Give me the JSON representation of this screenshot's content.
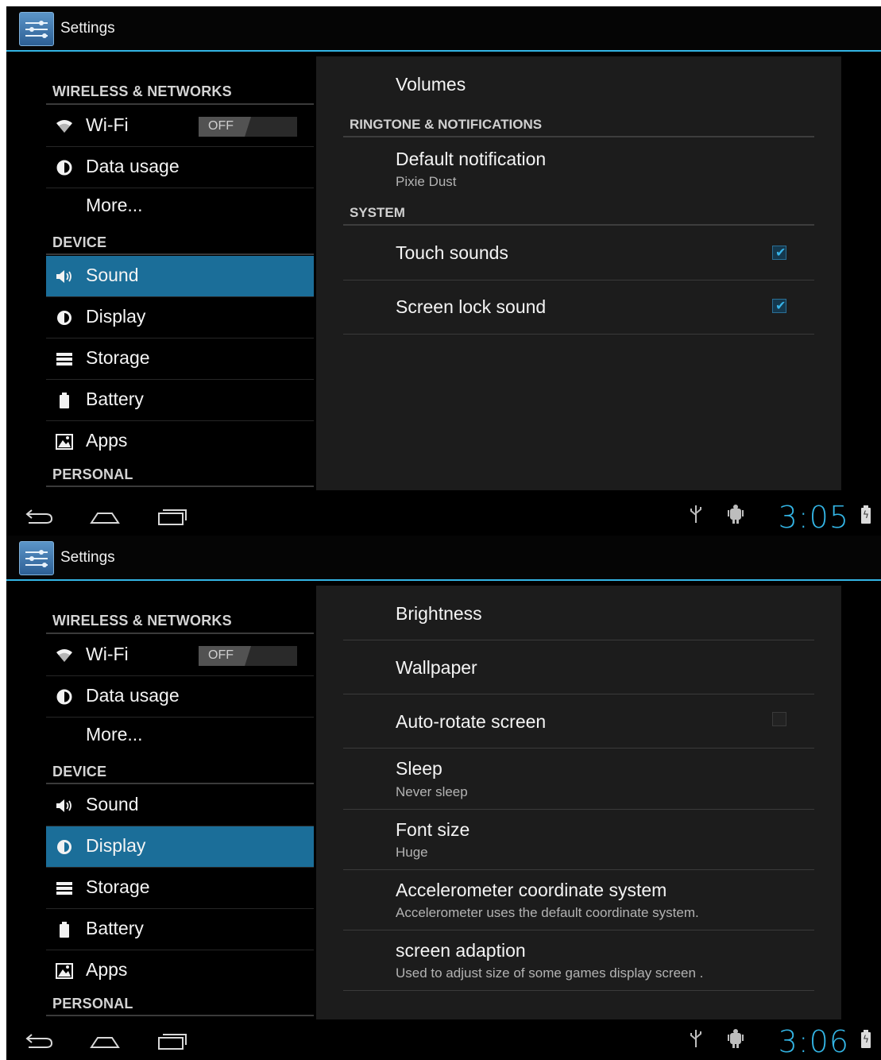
{
  "screens": [
    {
      "app_title": "Settings",
      "nav": {
        "wireless_header": "WIRELESS & NETWORKS",
        "wifi_label": "Wi-Fi",
        "wifi_toggle": "OFF",
        "data_usage": "Data usage",
        "more": "More...",
        "device_header": "DEVICE",
        "sound": "Sound",
        "display": "Display",
        "storage": "Storage",
        "battery": "Battery",
        "apps": "Apps",
        "personal_header": "PERSONAL",
        "selected": "Sound"
      },
      "detail": {
        "volumes": "Volumes",
        "ringtone_header": "RINGTONE & NOTIFICATIONS",
        "default_notification": "Default notification",
        "default_notification_summary": "Pixie Dust",
        "system_header": "SYSTEM",
        "touch_sounds": "Touch sounds",
        "touch_sounds_checked": true,
        "screen_lock_sound": "Screen lock sound",
        "screen_lock_sound_checked": true
      },
      "clock": "3:05"
    },
    {
      "app_title": "Settings",
      "nav": {
        "wireless_header": "WIRELESS & NETWORKS",
        "wifi_label": "Wi-Fi",
        "wifi_toggle": "OFF",
        "data_usage": "Data usage",
        "more": "More...",
        "device_header": "DEVICE",
        "sound": "Sound",
        "display": "Display",
        "storage": "Storage",
        "battery": "Battery",
        "apps": "Apps",
        "personal_header": "PERSONAL",
        "selected": "Display"
      },
      "detail": {
        "brightness": "Brightness",
        "wallpaper": "Wallpaper",
        "auto_rotate": "Auto-rotate screen",
        "auto_rotate_checked": false,
        "sleep": "Sleep",
        "sleep_summary": "Never sleep",
        "font_size": "Font size",
        "font_size_summary": "Huge",
        "accelerometer": "Accelerometer coordinate system",
        "accelerometer_summary": "Accelerometer uses the default coordinate system.",
        "screen_adaption": "screen adaption",
        "screen_adaption_summary": "Used to adjust size of some games display screen ."
      },
      "clock": "3:06"
    }
  ],
  "icons": {
    "app": "settings-icon",
    "wifi": "wifi-icon",
    "data_usage": "data-usage-icon",
    "sound": "speaker-icon",
    "display": "brightness-icon",
    "storage": "storage-icon",
    "battery": "battery-icon",
    "apps": "apps-icon",
    "back": "back-icon",
    "home": "home-icon",
    "recents": "recents-icon",
    "usb": "usb-icon",
    "debug": "android-debug-icon"
  },
  "colors": {
    "accent": "#33b5e5",
    "selected_item": "#1b6e99",
    "panel_bg": "#1c1c1c"
  }
}
